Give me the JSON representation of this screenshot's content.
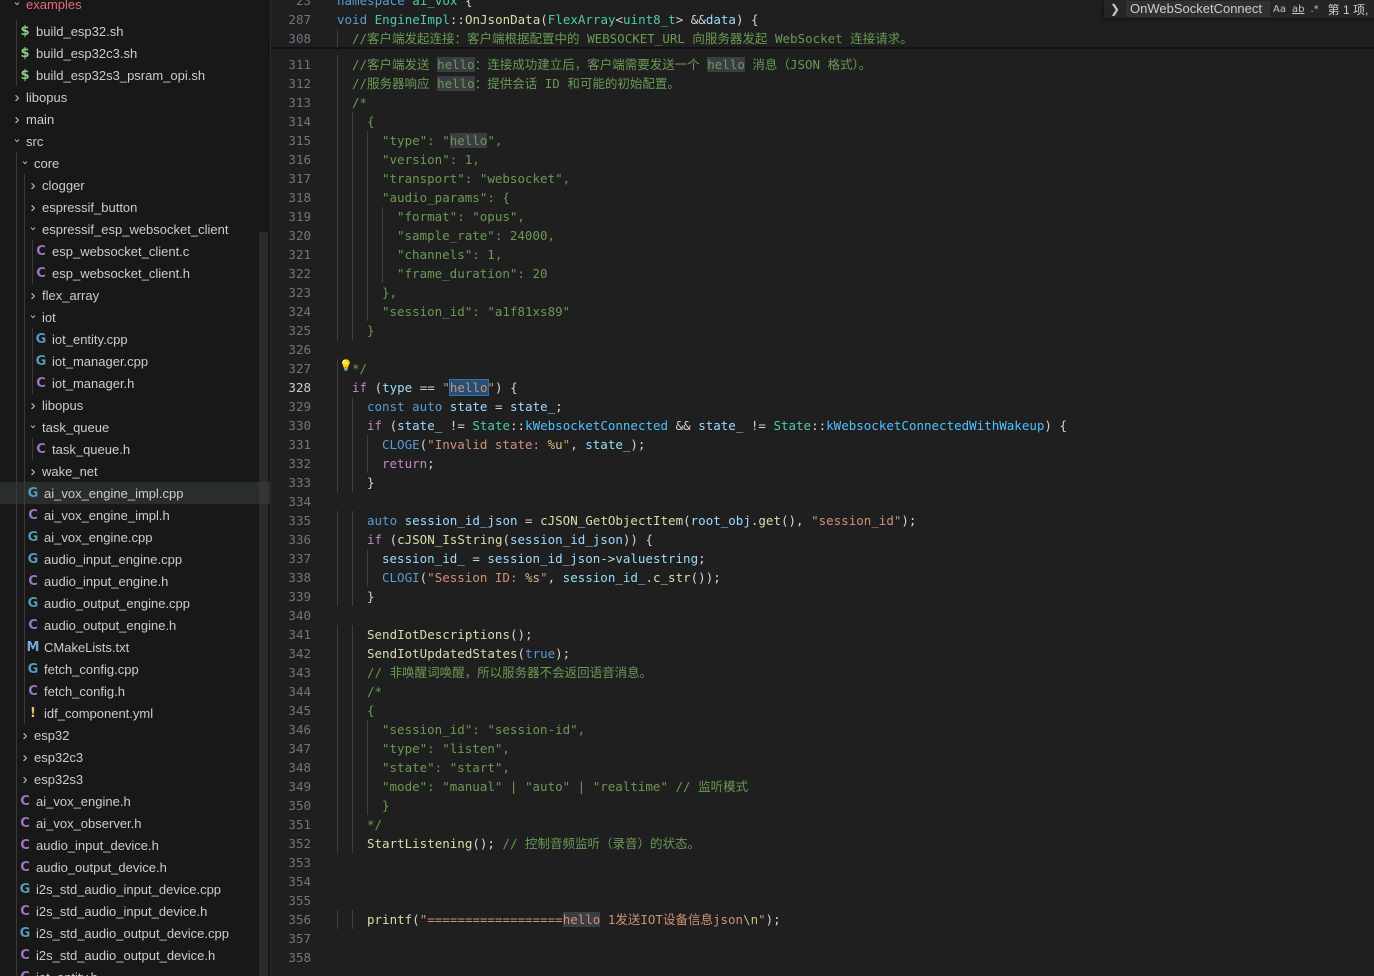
{
  "explorer": {
    "rows": [
      {
        "label": "examples",
        "type": "folder-open",
        "depth": 0,
        "partial": true
      },
      {
        "label": "build_esp32.sh",
        "type": "sh",
        "depth": 1
      },
      {
        "label": "build_esp32c3.sh",
        "type": "sh",
        "depth": 1
      },
      {
        "label": "build_esp32s3_psram_opi.sh",
        "type": "sh",
        "depth": 1
      },
      {
        "label": "libopus",
        "type": "folder",
        "depth": 0
      },
      {
        "label": "main",
        "type": "folder",
        "depth": 0
      },
      {
        "label": "src",
        "type": "folder-open",
        "depth": 0
      },
      {
        "label": "core",
        "type": "folder-open",
        "depth": 1
      },
      {
        "label": "clogger",
        "type": "folder",
        "depth": 2
      },
      {
        "label": "espressif_button",
        "type": "folder",
        "depth": 2
      },
      {
        "label": "espressif_esp_websocket_client",
        "type": "folder-open",
        "depth": 2
      },
      {
        "label": "esp_websocket_client.c",
        "type": "c",
        "depth": 3
      },
      {
        "label": "esp_websocket_client.h",
        "type": "c",
        "depth": 3
      },
      {
        "label": "flex_array",
        "type": "folder",
        "depth": 2
      },
      {
        "label": "iot",
        "type": "folder-open",
        "depth": 2
      },
      {
        "label": "iot_entity.cpp",
        "type": "cpp",
        "depth": 3
      },
      {
        "label": "iot_manager.cpp",
        "type": "cpp",
        "depth": 3
      },
      {
        "label": "iot_manager.h",
        "type": "c",
        "depth": 3
      },
      {
        "label": "libopus",
        "type": "folder",
        "depth": 2
      },
      {
        "label": "task_queue",
        "type": "folder-open",
        "depth": 2
      },
      {
        "label": "task_queue.h",
        "type": "c",
        "depth": 3
      },
      {
        "label": "wake_net",
        "type": "folder",
        "depth": 2
      },
      {
        "label": "ai_vox_engine_impl.cpp",
        "type": "cpp",
        "depth": 2,
        "selected": true
      },
      {
        "label": "ai_vox_engine_impl.h",
        "type": "c",
        "depth": 2
      },
      {
        "label": "ai_vox_engine.cpp",
        "type": "cpp",
        "depth": 2
      },
      {
        "label": "audio_input_engine.cpp",
        "type": "cpp",
        "depth": 2
      },
      {
        "label": "audio_input_engine.h",
        "type": "c",
        "depth": 2
      },
      {
        "label": "audio_output_engine.cpp",
        "type": "cpp",
        "depth": 2
      },
      {
        "label": "audio_output_engine.h",
        "type": "c",
        "depth": 2
      },
      {
        "label": "CMakeLists.txt",
        "type": "cmake",
        "depth": 2
      },
      {
        "label": "fetch_config.cpp",
        "type": "cpp",
        "depth": 2
      },
      {
        "label": "fetch_config.h",
        "type": "c",
        "depth": 2
      },
      {
        "label": "idf_component.yml",
        "type": "yml",
        "depth": 2
      },
      {
        "label": "esp32",
        "type": "folder",
        "depth": 1
      },
      {
        "label": "esp32c3",
        "type": "folder",
        "depth": 1
      },
      {
        "label": "esp32s3",
        "type": "folder",
        "depth": 1
      },
      {
        "label": "ai_vox_engine.h",
        "type": "c",
        "depth": 1
      },
      {
        "label": "ai_vox_observer.h",
        "type": "c",
        "depth": 1
      },
      {
        "label": "audio_input_device.h",
        "type": "c",
        "depth": 1
      },
      {
        "label": "audio_output_device.h",
        "type": "c",
        "depth": 1
      },
      {
        "label": "i2s_std_audio_input_device.cpp",
        "type": "cpp",
        "depth": 1
      },
      {
        "label": "i2s_std_audio_input_device.h",
        "type": "c",
        "depth": 1
      },
      {
        "label": "i2s_std_audio_output_device.cpp",
        "type": "cpp",
        "depth": 1
      },
      {
        "label": "i2s_std_audio_output_device.h",
        "type": "c",
        "depth": 1
      },
      {
        "label": "iot_entity.h",
        "type": "c",
        "depth": 1,
        "partial": true
      }
    ]
  },
  "find": {
    "query": "OnWebSocketConnect",
    "option_case": "Aa",
    "option_word": "ab",
    "option_regex": ".*",
    "result": "第 1 项,"
  },
  "editor": {
    "active_line": "328",
    "lines": [
      {
        "n": "23",
        "indent": 0,
        "tokens": [
          [
            "t-k",
            "namespace "
          ],
          [
            "t-ty",
            "ai_vox"
          ],
          [
            "t-p",
            " {"
          ]
        ]
      },
      {
        "n": "287",
        "indent": 0,
        "tokens": [
          [
            "t-k",
            "void "
          ],
          [
            "t-ty",
            "EngineImpl"
          ],
          [
            "t-p",
            "::"
          ],
          [
            "t-f",
            "OnJsonData"
          ],
          [
            "t-p",
            "("
          ],
          [
            "t-ty",
            "FlexArray"
          ],
          [
            "t-p",
            "<"
          ],
          [
            "t-ty",
            "uint8_t"
          ],
          [
            "t-p",
            "> &&"
          ],
          [
            "t-v",
            "data"
          ],
          [
            "t-p",
            ") {"
          ]
        ]
      },
      {
        "n": "308",
        "indent": 1,
        "tokens": [
          [
            "t-m",
            "//客户端发起连接：客户端根据配置中的 WEBSOCKET_URL 向服务器发起 WebSocket 连接请求。"
          ]
        ]
      },
      {
        "n": "311",
        "indent": 1,
        "tokens": [
          [
            "t-m",
            "//客户端发送 "
          ],
          [
            "t-m hl",
            "hello"
          ],
          [
            "t-m",
            "：连接成功建立后，客户端需要发送一个 "
          ],
          [
            "t-m hl",
            "hello"
          ],
          [
            "t-m",
            " 消息（JSON 格式）。"
          ]
        ]
      },
      {
        "n": "312",
        "indent": 1,
        "tokens": [
          [
            "t-m",
            "//服务器响应 "
          ],
          [
            "t-m hl",
            "hello"
          ],
          [
            "t-m",
            "：提供会话 ID 和可能的初始配置。"
          ]
        ]
      },
      {
        "n": "313",
        "indent": 1,
        "tokens": [
          [
            "t-m",
            "/*"
          ]
        ]
      },
      {
        "n": "314",
        "indent": 2,
        "tokens": [
          [
            "t-m",
            "{"
          ]
        ]
      },
      {
        "n": "315",
        "indent": 3,
        "tokens": [
          [
            "t-m",
            "\"type\": \""
          ],
          [
            "t-m hl",
            "hello"
          ],
          [
            "t-m",
            "\","
          ]
        ]
      },
      {
        "n": "316",
        "indent": 3,
        "tokens": [
          [
            "t-m",
            "\"version\": 1,"
          ]
        ]
      },
      {
        "n": "317",
        "indent": 3,
        "tokens": [
          [
            "t-m",
            "\"transport\": \"websocket\","
          ]
        ]
      },
      {
        "n": "318",
        "indent": 3,
        "tokens": [
          [
            "t-m",
            "\"audio_params\": {"
          ]
        ]
      },
      {
        "n": "319",
        "indent": 4,
        "tokens": [
          [
            "t-m",
            "\"format\": \"opus\","
          ]
        ]
      },
      {
        "n": "320",
        "indent": 4,
        "tokens": [
          [
            "t-m",
            "\"sample_rate\": 24000,"
          ]
        ]
      },
      {
        "n": "321",
        "indent": 4,
        "tokens": [
          [
            "t-m",
            "\"channels\": 1,"
          ]
        ]
      },
      {
        "n": "322",
        "indent": 4,
        "tokens": [
          [
            "t-m",
            "\"frame_duration\": 20"
          ]
        ]
      },
      {
        "n": "323",
        "indent": 3,
        "tokens": [
          [
            "t-m",
            "},"
          ]
        ]
      },
      {
        "n": "324",
        "indent": 3,
        "tokens": [
          [
            "t-m",
            "\"session_id\": \"a1f81xs89\""
          ]
        ]
      },
      {
        "n": "325",
        "indent": 2,
        "tokens": [
          [
            "t-m",
            "}"
          ]
        ]
      },
      {
        "n": "326",
        "indent": 0,
        "tokens": []
      },
      {
        "n": "327",
        "indent": 1,
        "tokens": [
          [
            "t-m",
            "*/"
          ]
        ]
      },
      {
        "n": "328",
        "indent": 1,
        "tokens": [
          [
            "t-c",
            "if "
          ],
          [
            "t-p",
            "("
          ],
          [
            "t-v",
            "type"
          ],
          [
            "t-p",
            " == "
          ],
          [
            "t-s",
            "\""
          ],
          [
            "t-s hl-strong",
            "hello"
          ],
          [
            "t-s",
            "\""
          ],
          [
            "t-p",
            ") {"
          ]
        ]
      },
      {
        "n": "329",
        "indent": 2,
        "tokens": [
          [
            "t-k",
            "const "
          ],
          [
            "t-k",
            "auto "
          ],
          [
            "t-v",
            "state"
          ],
          [
            "t-p",
            " = "
          ],
          [
            "t-v",
            "state_"
          ],
          [
            "t-p",
            ";"
          ]
        ]
      },
      {
        "n": "330",
        "indent": 2,
        "tokens": [
          [
            "t-c",
            "if "
          ],
          [
            "t-p",
            "("
          ],
          [
            "t-v",
            "state_"
          ],
          [
            "t-p",
            " != "
          ],
          [
            "t-ty",
            "State"
          ],
          [
            "t-p",
            "::"
          ],
          [
            "t-e",
            "kWebsocketConnected"
          ],
          [
            "t-p",
            " && "
          ],
          [
            "t-v",
            "state_"
          ],
          [
            "t-p",
            " != "
          ],
          [
            "t-ty",
            "State"
          ],
          [
            "t-p",
            "::"
          ],
          [
            "t-e",
            "kWebsocketConnectedWithWakeup"
          ],
          [
            "t-p",
            ") {"
          ]
        ]
      },
      {
        "n": "331",
        "indent": 3,
        "tokens": [
          [
            "t-mac",
            "CLOGE"
          ],
          [
            "t-p",
            "("
          ],
          [
            "t-s",
            "\"Invalid state: "
          ],
          [
            "t-esc",
            "%u"
          ],
          [
            "t-s",
            "\""
          ],
          [
            "t-p",
            ", "
          ],
          [
            "t-v",
            "state_"
          ],
          [
            "t-p",
            ");"
          ]
        ]
      },
      {
        "n": "332",
        "indent": 3,
        "tokens": [
          [
            "t-c",
            "return"
          ],
          [
            "t-p",
            ";"
          ]
        ]
      },
      {
        "n": "333",
        "indent": 2,
        "tokens": [
          [
            "t-p",
            "}"
          ]
        ]
      },
      {
        "n": "334",
        "indent": 0,
        "tokens": []
      },
      {
        "n": "335",
        "indent": 2,
        "tokens": [
          [
            "t-k",
            "auto "
          ],
          [
            "t-v",
            "session_id_json"
          ],
          [
            "t-p",
            " = "
          ],
          [
            "t-f",
            "cJSON_GetObjectItem"
          ],
          [
            "t-p",
            "("
          ],
          [
            "t-v",
            "root_obj"
          ],
          [
            "t-p",
            "."
          ],
          [
            "t-f",
            "get"
          ],
          [
            "t-p",
            "(), "
          ],
          [
            "t-s",
            "\"session_id\""
          ],
          [
            "t-p",
            ");"
          ]
        ]
      },
      {
        "n": "336",
        "indent": 2,
        "tokens": [
          [
            "t-c",
            "if "
          ],
          [
            "t-p",
            "("
          ],
          [
            "t-f",
            "cJSON_IsString"
          ],
          [
            "t-p",
            "("
          ],
          [
            "t-v",
            "session_id_json"
          ],
          [
            "t-p",
            ")) {"
          ]
        ]
      },
      {
        "n": "337",
        "indent": 3,
        "tokens": [
          [
            "t-v",
            "session_id_"
          ],
          [
            "t-p",
            " = "
          ],
          [
            "t-v",
            "session_id_json"
          ],
          [
            "t-p",
            "->"
          ],
          [
            "t-v",
            "valuestring"
          ],
          [
            "t-p",
            ";"
          ]
        ]
      },
      {
        "n": "338",
        "indent": 3,
        "tokens": [
          [
            "t-mac",
            "CLOGI"
          ],
          [
            "t-p",
            "("
          ],
          [
            "t-s",
            "\"Session ID: "
          ],
          [
            "t-esc",
            "%s"
          ],
          [
            "t-s",
            "\""
          ],
          [
            "t-p",
            ", "
          ],
          [
            "t-v",
            "session_id_"
          ],
          [
            "t-p",
            "."
          ],
          [
            "t-f",
            "c_str"
          ],
          [
            "t-p",
            "());"
          ]
        ]
      },
      {
        "n": "339",
        "indent": 2,
        "tokens": [
          [
            "t-p",
            "}"
          ]
        ]
      },
      {
        "n": "340",
        "indent": 0,
        "tokens": []
      },
      {
        "n": "341",
        "indent": 2,
        "tokens": [
          [
            "t-f",
            "SendIotDescriptions"
          ],
          [
            "t-p",
            "();"
          ]
        ]
      },
      {
        "n": "342",
        "indent": 2,
        "tokens": [
          [
            "t-f",
            "SendIotUpdatedStates"
          ],
          [
            "t-p",
            "("
          ],
          [
            "t-k",
            "true"
          ],
          [
            "t-p",
            ");"
          ]
        ]
      },
      {
        "n": "343",
        "indent": 2,
        "tokens": [
          [
            "t-m",
            "// 非唤醒词唤醒，所以服务器不会返回语音消息。"
          ]
        ]
      },
      {
        "n": "344",
        "indent": 2,
        "tokens": [
          [
            "t-m",
            "/*"
          ]
        ]
      },
      {
        "n": "345",
        "indent": 2,
        "tokens": [
          [
            "t-m",
            "{"
          ]
        ]
      },
      {
        "n": "346",
        "indent": 3,
        "tokens": [
          [
            "t-m",
            "\"session_id\": \"session-id\","
          ]
        ]
      },
      {
        "n": "347",
        "indent": 3,
        "tokens": [
          [
            "t-m",
            "\"type\": \"listen\","
          ]
        ]
      },
      {
        "n": "348",
        "indent": 3,
        "tokens": [
          [
            "t-m",
            "\"state\": \"start\","
          ]
        ]
      },
      {
        "n": "349",
        "indent": 3,
        "tokens": [
          [
            "t-m",
            "\"mode\": \"manual\" | \"auto\" | \"realtime\" // 监听模式"
          ]
        ]
      },
      {
        "n": "350",
        "indent": 3,
        "tokens": [
          [
            "t-m",
            "}"
          ]
        ]
      },
      {
        "n": "351",
        "indent": 2,
        "tokens": [
          [
            "t-m",
            "*/"
          ]
        ]
      },
      {
        "n": "352",
        "indent": 2,
        "tokens": [
          [
            "t-f",
            "StartListening"
          ],
          [
            "t-p",
            "(); "
          ],
          [
            "t-m",
            "// 控制音频监听（录音）的状态。"
          ]
        ]
      },
      {
        "n": "353",
        "indent": 0,
        "tokens": []
      },
      {
        "n": "354",
        "indent": 0,
        "tokens": []
      },
      {
        "n": "355",
        "indent": 0,
        "tokens": []
      },
      {
        "n": "356",
        "indent": 2,
        "tokens": [
          [
            "t-f",
            "printf"
          ],
          [
            "t-p",
            "("
          ],
          [
            "t-s",
            "\"=================="
          ],
          [
            "t-s hl",
            "hello"
          ],
          [
            "t-s",
            " 1发送IOT设备信息json"
          ],
          [
            "t-esc",
            "\\n"
          ],
          [
            "t-s",
            "\""
          ],
          [
            "t-p",
            ");"
          ]
        ]
      },
      {
        "n": "357",
        "indent": 0,
        "tokens": []
      },
      {
        "n": "358",
        "indent": 0,
        "tokens": []
      }
    ]
  }
}
